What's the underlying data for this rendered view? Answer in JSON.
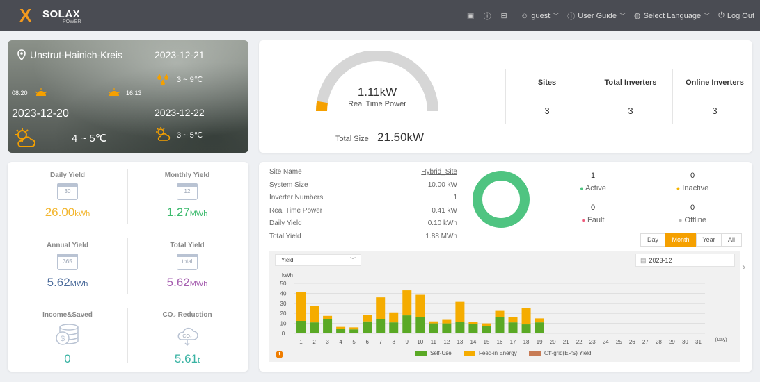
{
  "header": {
    "logo": {
      "mark": "X",
      "brand": "SOLAX",
      "sub": "POWER"
    },
    "icons": [
      "screen-icon",
      "info-icon",
      "book-icon"
    ],
    "user": "guest",
    "user_guide": "User Guide",
    "language": "Select Language",
    "logout": "Log Out"
  },
  "weather": {
    "location": "Unstrut-Hainich-Kreis",
    "sunrise": "08:20",
    "sunset": "16:13",
    "today_date": "2023-12-20",
    "today_temp": "4 ~ 5℃",
    "day2_date": "2023-12-21",
    "day2_temp": "3 ~ 9℃",
    "day3_date": "2023-12-22",
    "day3_temp": "3 ~ 5℃"
  },
  "power": {
    "value": "1.11kW",
    "label": "Real Time Power",
    "total_size_label": "Total Size",
    "total_size_value": "21.50kW",
    "gauge_fraction": 0.052
  },
  "summary": [
    {
      "label": "Sites",
      "value": "3"
    },
    {
      "label": "Total Inverters",
      "value": "3"
    },
    {
      "label": "Online Inverters",
      "value": "3"
    }
  ],
  "yields": {
    "daily": {
      "label": "Daily Yield",
      "icon_text": "30",
      "value": "26.00",
      "unit": "kWh"
    },
    "monthly": {
      "label": "Monthly Yield",
      "icon_text": "12",
      "value": "1.27",
      "unit": "MWh"
    },
    "annual": {
      "label": "Annual Yield",
      "icon_text": "365",
      "value": "5.62",
      "unit": "MWh"
    },
    "total": {
      "label": "Total Yield",
      "icon_text": "total",
      "value": "5.62",
      "unit": "MWh"
    },
    "income": {
      "label": "Income&Saved",
      "value": "0"
    },
    "co2": {
      "label": "CO₂ Reduction",
      "icon_text": "CO₂",
      "value": "5.61",
      "unit": "t"
    }
  },
  "site": {
    "rows": [
      {
        "label": "Site Name",
        "value": "Hybrid_Site"
      },
      {
        "label": "System Size",
        "value": "10.00 kW"
      },
      {
        "label": "Inverter Numbers",
        "value": "1"
      },
      {
        "label": "Real Time Power",
        "value": "0.41 kW"
      },
      {
        "label": "Daily Yield",
        "value": "0.10 kWh"
      },
      {
        "label": "Total Yield",
        "value": "1.88 MWh"
      }
    ]
  },
  "status": {
    "active": {
      "count": "1",
      "label": "Active"
    },
    "inactive": {
      "count": "0",
      "label": "Inactive"
    },
    "fault": {
      "count": "0",
      "label": "Fault"
    },
    "offline": {
      "count": "0",
      "label": "Offline"
    }
  },
  "range_buttons": [
    "Day",
    "Month",
    "Year",
    "All"
  ],
  "range_selected": "Month",
  "chart_controls": {
    "type_select": "Yield",
    "date": "2023-12"
  },
  "chart_data": {
    "type": "bar",
    "stacked": true,
    "ylabel": "kWh",
    "xlabel": "(Day)",
    "ylim": [
      0,
      50
    ],
    "yticks": [
      0,
      10,
      20,
      30,
      40,
      50
    ],
    "categories": [
      "1",
      "2",
      "3",
      "4",
      "5",
      "6",
      "7",
      "8",
      "9",
      "10",
      "11",
      "12",
      "13",
      "14",
      "15",
      "16",
      "17",
      "18",
      "19",
      "20",
      "21",
      "22",
      "23",
      "24",
      "25",
      "26",
      "27",
      "28",
      "29",
      "30",
      "31"
    ],
    "series": [
      {
        "name": "Self-Use",
        "color": "#5aa925",
        "values": [
          12.5,
          11,
          14.5,
          4.5,
          4,
          12,
          14,
          11,
          18,
          16.5,
          10,
          10,
          11.5,
          9.5,
          7,
          16,
          11,
          9,
          11,
          0,
          0,
          0,
          0,
          0,
          0,
          0,
          0,
          0,
          0,
          0,
          0
        ]
      },
      {
        "name": "Feed-in Energy",
        "color": "#f5ac00",
        "values": [
          29,
          16.5,
          3,
          2,
          2,
          6.5,
          22,
          10,
          25,
          22,
          2,
          3.5,
          20,
          2,
          3,
          6.5,
          5.5,
          16.5,
          4,
          0,
          0,
          0,
          0,
          0,
          0,
          0,
          0,
          0,
          0,
          0,
          0
        ]
      },
      {
        "name": "Off-grid(EPS) Yield",
        "color": "#c77b55",
        "values": [
          0,
          0,
          0,
          0,
          0,
          0,
          0,
          0,
          0,
          0,
          0,
          0,
          0,
          0,
          0,
          0,
          0,
          0,
          0,
          0,
          0,
          0,
          0,
          0,
          0,
          0,
          0,
          0,
          0,
          0,
          0
        ]
      }
    ]
  },
  "colors": {
    "accent": "#f5a000",
    "active": "#4fc481",
    "inactive": "#f5b400",
    "fault": "#ef5b7b",
    "offline": "#b5b5b5",
    "daily": "#f3b62e",
    "monthly": "#3dbb6e",
    "annual": "#4a6a9a",
    "total": "#a65fb0",
    "teal": "#39b3a3"
  }
}
